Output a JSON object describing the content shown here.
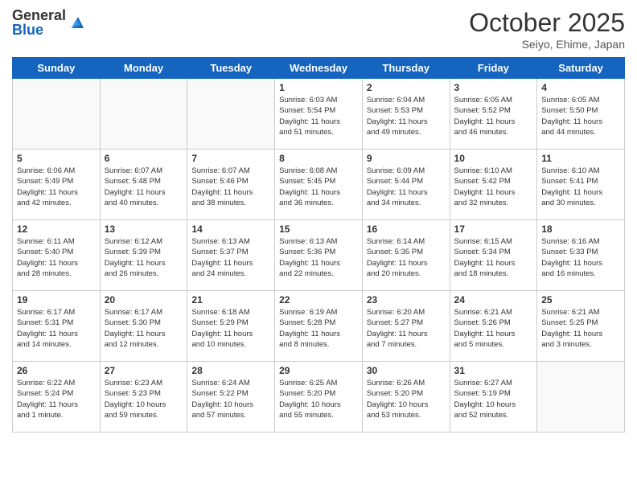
{
  "header": {
    "logo_general": "General",
    "logo_blue": "Blue",
    "month": "October 2025",
    "location": "Seiyo, Ehime, Japan"
  },
  "weekdays": [
    "Sunday",
    "Monday",
    "Tuesday",
    "Wednesday",
    "Thursday",
    "Friday",
    "Saturday"
  ],
  "weeks": [
    [
      {
        "day": "",
        "info": ""
      },
      {
        "day": "",
        "info": ""
      },
      {
        "day": "",
        "info": ""
      },
      {
        "day": "1",
        "info": "Sunrise: 6:03 AM\nSunset: 5:54 PM\nDaylight: 11 hours\nand 51 minutes."
      },
      {
        "day": "2",
        "info": "Sunrise: 6:04 AM\nSunset: 5:53 PM\nDaylight: 11 hours\nand 49 minutes."
      },
      {
        "day": "3",
        "info": "Sunrise: 6:05 AM\nSunset: 5:52 PM\nDaylight: 11 hours\nand 46 minutes."
      },
      {
        "day": "4",
        "info": "Sunrise: 6:05 AM\nSunset: 5:50 PM\nDaylight: 11 hours\nand 44 minutes."
      }
    ],
    [
      {
        "day": "5",
        "info": "Sunrise: 6:06 AM\nSunset: 5:49 PM\nDaylight: 11 hours\nand 42 minutes."
      },
      {
        "day": "6",
        "info": "Sunrise: 6:07 AM\nSunset: 5:48 PM\nDaylight: 11 hours\nand 40 minutes."
      },
      {
        "day": "7",
        "info": "Sunrise: 6:07 AM\nSunset: 5:46 PM\nDaylight: 11 hours\nand 38 minutes."
      },
      {
        "day": "8",
        "info": "Sunrise: 6:08 AM\nSunset: 5:45 PM\nDaylight: 11 hours\nand 36 minutes."
      },
      {
        "day": "9",
        "info": "Sunrise: 6:09 AM\nSunset: 5:44 PM\nDaylight: 11 hours\nand 34 minutes."
      },
      {
        "day": "10",
        "info": "Sunrise: 6:10 AM\nSunset: 5:42 PM\nDaylight: 11 hours\nand 32 minutes."
      },
      {
        "day": "11",
        "info": "Sunrise: 6:10 AM\nSunset: 5:41 PM\nDaylight: 11 hours\nand 30 minutes."
      }
    ],
    [
      {
        "day": "12",
        "info": "Sunrise: 6:11 AM\nSunset: 5:40 PM\nDaylight: 11 hours\nand 28 minutes."
      },
      {
        "day": "13",
        "info": "Sunrise: 6:12 AM\nSunset: 5:39 PM\nDaylight: 11 hours\nand 26 minutes."
      },
      {
        "day": "14",
        "info": "Sunrise: 6:13 AM\nSunset: 5:37 PM\nDaylight: 11 hours\nand 24 minutes."
      },
      {
        "day": "15",
        "info": "Sunrise: 6:13 AM\nSunset: 5:36 PM\nDaylight: 11 hours\nand 22 minutes."
      },
      {
        "day": "16",
        "info": "Sunrise: 6:14 AM\nSunset: 5:35 PM\nDaylight: 11 hours\nand 20 minutes."
      },
      {
        "day": "17",
        "info": "Sunrise: 6:15 AM\nSunset: 5:34 PM\nDaylight: 11 hours\nand 18 minutes."
      },
      {
        "day": "18",
        "info": "Sunrise: 6:16 AM\nSunset: 5:33 PM\nDaylight: 11 hours\nand 16 minutes."
      }
    ],
    [
      {
        "day": "19",
        "info": "Sunrise: 6:17 AM\nSunset: 5:31 PM\nDaylight: 11 hours\nand 14 minutes."
      },
      {
        "day": "20",
        "info": "Sunrise: 6:17 AM\nSunset: 5:30 PM\nDaylight: 11 hours\nand 12 minutes."
      },
      {
        "day": "21",
        "info": "Sunrise: 6:18 AM\nSunset: 5:29 PM\nDaylight: 11 hours\nand 10 minutes."
      },
      {
        "day": "22",
        "info": "Sunrise: 6:19 AM\nSunset: 5:28 PM\nDaylight: 11 hours\nand 8 minutes."
      },
      {
        "day": "23",
        "info": "Sunrise: 6:20 AM\nSunset: 5:27 PM\nDaylight: 11 hours\nand 7 minutes."
      },
      {
        "day": "24",
        "info": "Sunrise: 6:21 AM\nSunset: 5:26 PM\nDaylight: 11 hours\nand 5 minutes."
      },
      {
        "day": "25",
        "info": "Sunrise: 6:21 AM\nSunset: 5:25 PM\nDaylight: 11 hours\nand 3 minutes."
      }
    ],
    [
      {
        "day": "26",
        "info": "Sunrise: 6:22 AM\nSunset: 5:24 PM\nDaylight: 11 hours\nand 1 minute."
      },
      {
        "day": "27",
        "info": "Sunrise: 6:23 AM\nSunset: 5:23 PM\nDaylight: 10 hours\nand 59 minutes."
      },
      {
        "day": "28",
        "info": "Sunrise: 6:24 AM\nSunset: 5:22 PM\nDaylight: 10 hours\nand 57 minutes."
      },
      {
        "day": "29",
        "info": "Sunrise: 6:25 AM\nSunset: 5:20 PM\nDaylight: 10 hours\nand 55 minutes."
      },
      {
        "day": "30",
        "info": "Sunrise: 6:26 AM\nSunset: 5:20 PM\nDaylight: 10 hours\nand 53 minutes."
      },
      {
        "day": "31",
        "info": "Sunrise: 6:27 AM\nSunset: 5:19 PM\nDaylight: 10 hours\nand 52 minutes."
      },
      {
        "day": "",
        "info": ""
      }
    ]
  ]
}
